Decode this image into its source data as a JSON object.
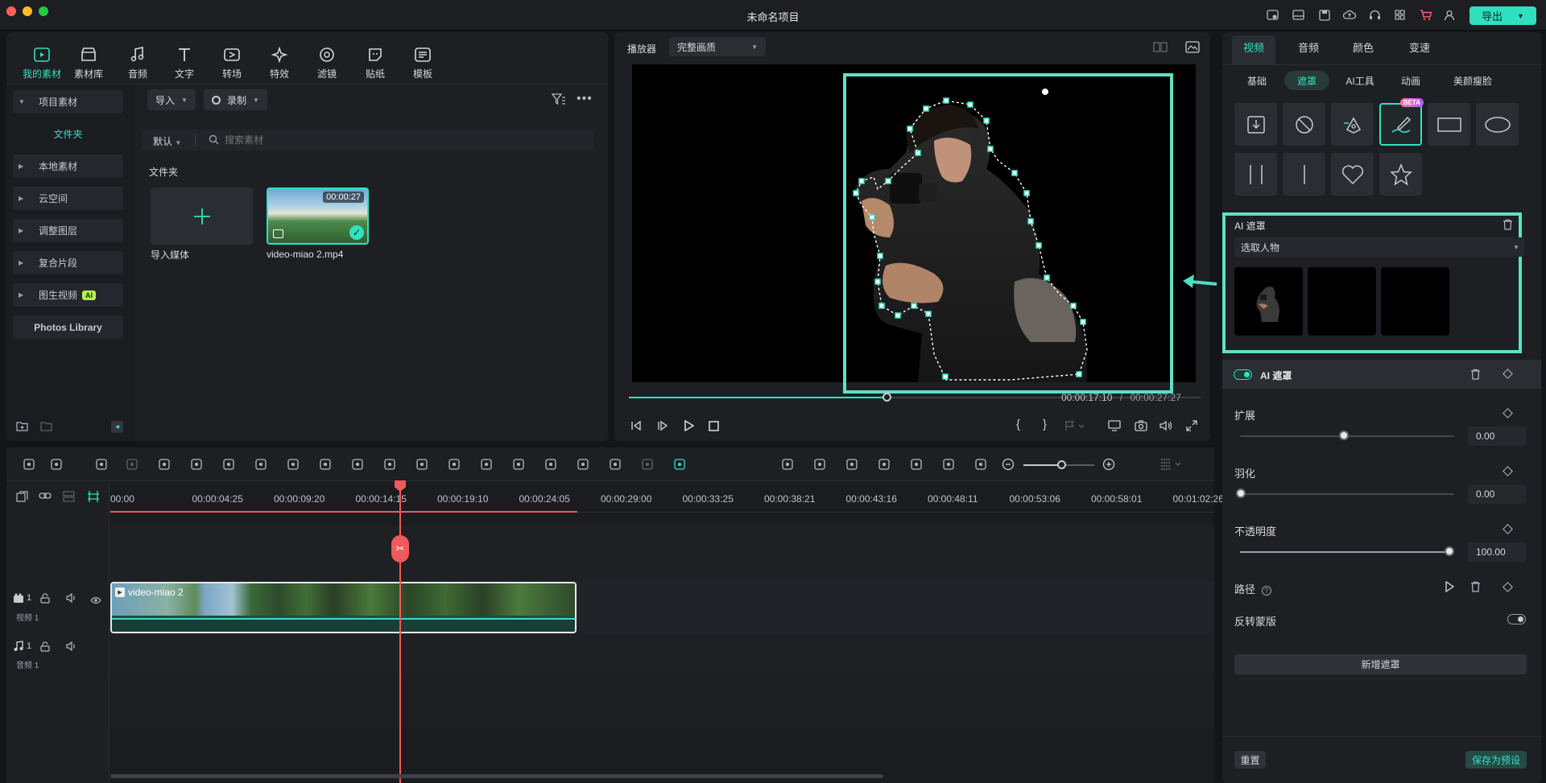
{
  "window": {
    "title": "未命名项目",
    "export_label": "导出"
  },
  "colors": {
    "accent": "#33e0c2",
    "playhead": "#f05a5a",
    "bg": "#131519",
    "panel": "#1d1f23"
  },
  "media_toolbar": [
    {
      "label": "我的素材",
      "icon": "my-media-icon",
      "active": true
    },
    {
      "label": "素材库",
      "icon": "stock-media-icon"
    },
    {
      "label": "音频",
      "icon": "audio-icon"
    },
    {
      "label": "文字",
      "icon": "text-icon"
    },
    {
      "label": "转场",
      "icon": "transition-icon"
    },
    {
      "label": "特效",
      "icon": "effects-icon"
    },
    {
      "label": "滤镜",
      "icon": "filter-icon"
    },
    {
      "label": "贴纸",
      "icon": "sticker-icon"
    },
    {
      "label": "模板",
      "icon": "template-icon"
    }
  ],
  "sidebar": {
    "project_media": "项目素材",
    "folder": "文件夹",
    "items": [
      "本地素材",
      "云空间",
      "调整图层",
      "复合片段",
      "图生视频"
    ],
    "ai_badge": "AI",
    "photos": "Photos Library"
  },
  "library": {
    "import_label": "导入",
    "record_label": "录制",
    "sort_label": "默认",
    "search_placeholder": "搜索素材",
    "section_title": "文件夹",
    "import_media": "导入媒体",
    "clip_name": "video-miao 2.mp4",
    "clip_duration": "00:00:27"
  },
  "player": {
    "label": "播放器",
    "quality": "完整画质",
    "current_time": "00:00:17:10",
    "separator": "/",
    "total_time": "00:00:27:27",
    "progress": 0.45
  },
  "timeline": {
    "ruler": [
      "00:00",
      "00:00:04:25",
      "00:00:09:20",
      "00:00:14:15",
      "00:00:19:10",
      "00:00:24:05",
      "00:00:29:00",
      "00:00:33:25",
      "00:00:38:21",
      "00:00:43:16",
      "00:00:48:11",
      "00:00:53:06",
      "00:00:58:01",
      "00:01:02:26"
    ],
    "video_track_num": "1",
    "video_track_label": "视频 1",
    "audio_track_num": "1",
    "audio_track_label": "音频 1",
    "clip_label": "video-miao 2"
  },
  "inspector": {
    "tabs": [
      "视频",
      "音频",
      "颜色",
      "变速"
    ],
    "subtabs": [
      "基础",
      "遮罩",
      "AI工具",
      "动画",
      "美颜瘦脸"
    ],
    "beta": "BETA",
    "ai_mask_title": "AI 遮罩",
    "select_person": "选取人物",
    "ai_mask_layer": "AI 遮罩",
    "expand_label": "扩展",
    "expand_value": "0.00",
    "feather_label": "羽化",
    "feather_value": "0.00",
    "opacity_label": "不透明度",
    "opacity_value": "100.00",
    "path_label": "路径",
    "invert_label": "反转蒙版",
    "add_mask": "新增遮罩",
    "reset": "重置",
    "save_preset": "保存为预设"
  }
}
